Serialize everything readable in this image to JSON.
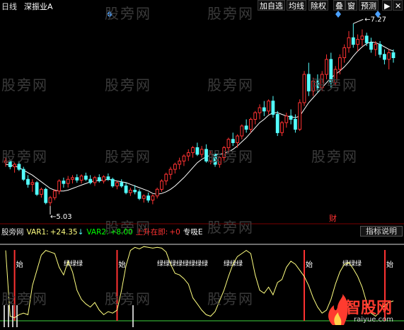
{
  "header": {
    "period": "日线",
    "stock_name": "深振业A"
  },
  "toolbar": {
    "buttons": [
      "加自选",
      "均线",
      "除权",
      "叠",
      "窗",
      "预测"
    ]
  },
  "price_labels": {
    "high": "7.27",
    "low": "5.03"
  },
  "event_marker": "财",
  "indicator": {
    "name": "股旁网",
    "var1_label": "VAR1:",
    "var1_value": "+24.35",
    "var1_arrow": "↓",
    "var2_label": "VAR2:",
    "var2_value": "+8.00",
    "rise_label": "上升在即:",
    "rise_value": "+0",
    "absorb_label": "专吸E",
    "explain_button": "指标说明",
    "signal_start": "始",
    "signal_text": "绿绿绿",
    "signal_text_long": "绿绿绿绿绿绿绿绿"
  },
  "watermarks": [
    "股旁网"
  ],
  "logo": {
    "main": "智股网",
    "sub": "raiyue.com"
  },
  "colors": {
    "background": "#000000",
    "up_candle": "#ff3232",
    "down_candle": "#54ffff",
    "flat_candle": "#ffffff",
    "ma_line": "#ffffff",
    "var1_line": "#ffff80",
    "var2_line": "#ffffff",
    "signal_bar": "#ff3232",
    "green_text": "#00ff00",
    "label_yellow": "#ffff00",
    "label_red": "#ff3232"
  },
  "chart_data": {
    "type": "candlestick",
    "series": [
      {
        "name": "price",
        "values": []
      }
    ],
    "price_range": [
      4.9,
      7.4
    ],
    "ohlc": [
      [
        5.6,
        5.66,
        5.55,
        5.62
      ],
      [
        5.62,
        5.64,
        5.52,
        5.55
      ],
      [
        5.55,
        5.6,
        5.48,
        5.58
      ],
      [
        5.58,
        5.62,
        5.5,
        5.52
      ],
      [
        5.52,
        5.55,
        5.38,
        5.4
      ],
      [
        5.4,
        5.45,
        5.3,
        5.34
      ],
      [
        5.34,
        5.4,
        5.25,
        5.36
      ],
      [
        5.36,
        5.38,
        5.2,
        5.22
      ],
      [
        5.22,
        5.3,
        5.18,
        5.28
      ],
      [
        5.28,
        5.3,
        5.1,
        5.12
      ],
      [
        5.12,
        5.2,
        5.08,
        5.18
      ],
      [
        5.18,
        5.28,
        5.15,
        5.26
      ],
      [
        5.26,
        5.4,
        5.22,
        5.38
      ],
      [
        5.38,
        5.42,
        5.3,
        5.35
      ],
      [
        5.35,
        5.44,
        5.3,
        5.4
      ],
      [
        5.4,
        5.45,
        5.35,
        5.42
      ],
      [
        5.42,
        5.46,
        5.36,
        5.39
      ],
      [
        5.39,
        5.46,
        5.35,
        5.44
      ],
      [
        5.44,
        5.48,
        5.38,
        5.4
      ],
      [
        5.4,
        5.45,
        5.34,
        5.36
      ],
      [
        5.36,
        5.44,
        5.32,
        5.42
      ],
      [
        5.42,
        5.46,
        5.36,
        5.38
      ],
      [
        5.38,
        5.45,
        5.35,
        5.43
      ],
      [
        5.43,
        5.47,
        5.38,
        5.4
      ],
      [
        5.4,
        5.42,
        5.3,
        5.32
      ],
      [
        5.32,
        5.38,
        5.28,
        5.36
      ],
      [
        5.36,
        5.4,
        5.3,
        5.32
      ],
      [
        5.32,
        5.36,
        5.22,
        5.24
      ],
      [
        5.24,
        5.3,
        5.2,
        5.27
      ],
      [
        5.27,
        5.33,
        5.22,
        5.25
      ],
      [
        5.25,
        5.28,
        5.15,
        5.17
      ],
      [
        5.17,
        5.22,
        5.12,
        5.2
      ],
      [
        5.2,
        5.24,
        5.12,
        5.15
      ],
      [
        5.15,
        5.22,
        5.1,
        5.2
      ],
      [
        5.2,
        5.3,
        5.17,
        5.28
      ],
      [
        5.28,
        5.4,
        5.25,
        5.38
      ],
      [
        5.38,
        5.48,
        5.33,
        5.46
      ],
      [
        5.46,
        5.55,
        5.4,
        5.52
      ],
      [
        5.52,
        5.6,
        5.47,
        5.58
      ],
      [
        5.58,
        5.66,
        5.52,
        5.62
      ],
      [
        5.62,
        5.7,
        5.56,
        5.68
      ],
      [
        5.68,
        5.76,
        5.62,
        5.72
      ],
      [
        5.72,
        5.8,
        5.66,
        5.78
      ],
      [
        5.78,
        5.84,
        5.68,
        5.7
      ],
      [
        5.7,
        5.8,
        5.66,
        5.76
      ],
      [
        5.76,
        5.82,
        5.6,
        5.62
      ],
      [
        5.62,
        5.74,
        5.58,
        5.7
      ],
      [
        5.7,
        5.74,
        5.55,
        5.58
      ],
      [
        5.58,
        5.68,
        5.54,
        5.66
      ],
      [
        5.66,
        5.8,
        5.62,
        5.78
      ],
      [
        5.78,
        5.9,
        5.72,
        5.88
      ],
      [
        5.88,
        5.96,
        5.8,
        5.84
      ],
      [
        5.84,
        5.94,
        5.78,
        5.92
      ],
      [
        5.92,
        6.06,
        5.88,
        6.04
      ],
      [
        6.04,
        6.12,
        5.96,
        6.0
      ],
      [
        6.0,
        6.14,
        5.96,
        6.12
      ],
      [
        6.12,
        6.22,
        6.06,
        6.2
      ],
      [
        6.2,
        6.3,
        6.12,
        6.26
      ],
      [
        6.26,
        6.34,
        6.16,
        6.22
      ],
      [
        6.22,
        6.36,
        6.18,
        6.34
      ],
      [
        6.34,
        6.4,
        6.14,
        6.18
      ],
      [
        6.18,
        6.22,
        5.92,
        5.96
      ],
      [
        5.96,
        6.1,
        5.92,
        6.08
      ],
      [
        6.08,
        6.2,
        6.02,
        6.16
      ],
      [
        6.16,
        6.24,
        6.06,
        6.12
      ],
      [
        6.12,
        6.18,
        5.96,
        6.0
      ],
      [
        6.0,
        6.36,
        5.98,
        6.32
      ],
      [
        6.32,
        6.7,
        6.28,
        6.66
      ],
      [
        6.66,
        6.8,
        6.4,
        6.46
      ],
      [
        6.46,
        6.62,
        6.4,
        6.58
      ],
      [
        6.58,
        6.66,
        6.44,
        6.5
      ],
      [
        6.5,
        6.7,
        6.46,
        6.66
      ],
      [
        6.66,
        6.9,
        6.6,
        6.84
      ],
      [
        6.84,
        6.92,
        6.5,
        6.56
      ],
      [
        6.56,
        6.76,
        6.52,
        6.72
      ],
      [
        6.72,
        6.9,
        6.66,
        6.86
      ],
      [
        6.86,
        7.02,
        6.8,
        6.98
      ],
      [
        6.98,
        7.18,
        6.92,
        7.1
      ],
      [
        7.1,
        7.27,
        6.98,
        7.02
      ],
      [
        7.02,
        7.14,
        6.94,
        7.08
      ],
      [
        7.08,
        7.2,
        7.0,
        7.12
      ],
      [
        7.12,
        7.16,
        7.0,
        7.04
      ],
      [
        7.04,
        7.1,
        6.92,
        6.96
      ],
      [
        6.96,
        7.06,
        6.88,
        7.02
      ],
      [
        7.02,
        7.06,
        6.86,
        6.9
      ],
      [
        6.9,
        6.96,
        6.78,
        6.84
      ],
      [
        6.84,
        6.96,
        6.72,
        6.92
      ],
      [
        6.92,
        6.96,
        6.8,
        6.86
      ]
    ],
    "ma": [
      5.58,
      5.57,
      5.56,
      5.54,
      5.51,
      5.48,
      5.45,
      5.41,
      5.37,
      5.33,
      5.29,
      5.27,
      5.26,
      5.26,
      5.27,
      5.29,
      5.31,
      5.33,
      5.35,
      5.37,
      5.38,
      5.39,
      5.39,
      5.4,
      5.39,
      5.38,
      5.37,
      5.36,
      5.34,
      5.32,
      5.3,
      5.28,
      5.26,
      5.23,
      5.22,
      5.23,
      5.25,
      5.28,
      5.32,
      5.37,
      5.42,
      5.48,
      5.54,
      5.6,
      5.64,
      5.67,
      5.69,
      5.7,
      5.7,
      5.71,
      5.73,
      5.76,
      5.8,
      5.85,
      5.9,
      5.96,
      6.02,
      6.08,
      6.12,
      6.17,
      6.2,
      6.2,
      6.18,
      6.16,
      6.15,
      6.14,
      6.16,
      6.24,
      6.32,
      6.38,
      6.44,
      6.5,
      6.56,
      6.62,
      6.66,
      6.7,
      6.75,
      6.81,
      6.88,
      6.94,
      6.99,
      7.03,
      7.05,
      7.04,
      7.02,
      6.99,
      6.96,
      6.94
    ],
    "var1": [
      92,
      6,
      4,
      8,
      10,
      8,
      46,
      66,
      86,
      92,
      90,
      88,
      70,
      60,
      78,
      64,
      40,
      28,
      22,
      18,
      24,
      14,
      8,
      12,
      10,
      14,
      40,
      72,
      92,
      96,
      94,
      97,
      96,
      95,
      96,
      95,
      90,
      74,
      62,
      60,
      55,
      48,
      30,
      22,
      14,
      8,
      6,
      12,
      26,
      40,
      58,
      74,
      84,
      88,
      92,
      88,
      60,
      40,
      36,
      44,
      34,
      50,
      54,
      70,
      78,
      74,
      66,
      58,
      46,
      30,
      18,
      10,
      14,
      28,
      48,
      64,
      74,
      76,
      68,
      58,
      44,
      24,
      10,
      6,
      12,
      20,
      24,
      26
    ],
    "var2": [],
    "signals_start_index": [
      2,
      25,
      67
    ],
    "ylim_indicator": [
      0,
      100
    ]
  }
}
